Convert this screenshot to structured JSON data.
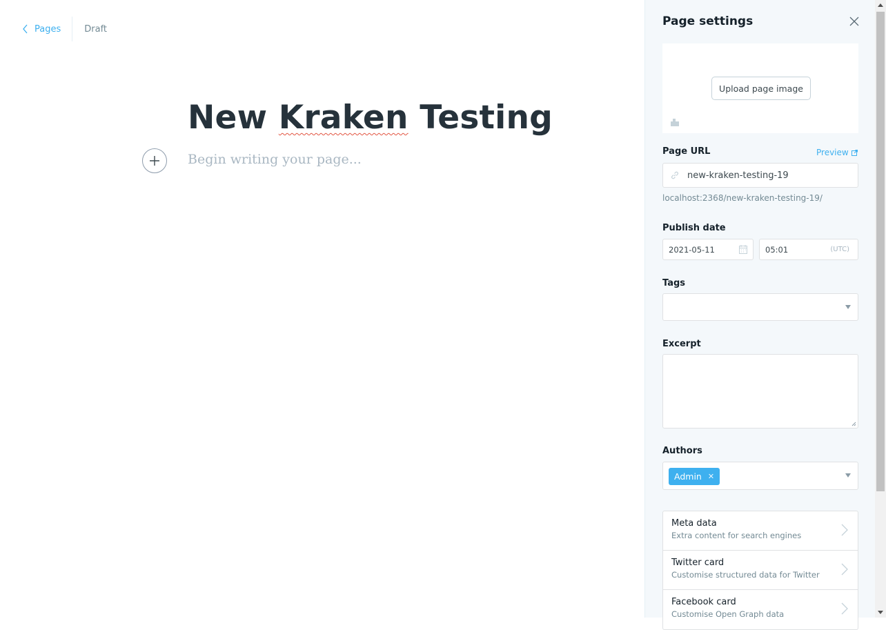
{
  "editor": {
    "back_label": "Pages",
    "status": "Draft",
    "title_part1": "New ",
    "title_misspelled": "Kraken",
    "title_part2": " Testing",
    "body_placeholder": "Begin writing your page..."
  },
  "settings": {
    "title": "Page settings",
    "upload_label": "Upload page image",
    "url_label": "Page URL",
    "preview_label": "Preview",
    "url_value": "new-kraken-testing-19",
    "url_full": "localhost:2368/new-kraken-testing-19/",
    "publish_label": "Publish date",
    "publish_date": "2021-05-11",
    "publish_time": "05:01",
    "timezone": "(UTC)",
    "tags_label": "Tags",
    "excerpt_label": "Excerpt",
    "authors_label": "Authors",
    "author_token": "Admin",
    "nav_items": [
      {
        "title": "Meta data",
        "subtitle": "Extra content for search engines"
      },
      {
        "title": "Twitter card",
        "subtitle": "Customise structured data for Twitter"
      },
      {
        "title": "Facebook card",
        "subtitle": "Customise Open Graph data"
      }
    ]
  },
  "colors": {
    "accent": "#3eb0ef",
    "title_text": "#26323b",
    "muted_text": "#738a94",
    "panel_bg": "#f4f8fb"
  }
}
